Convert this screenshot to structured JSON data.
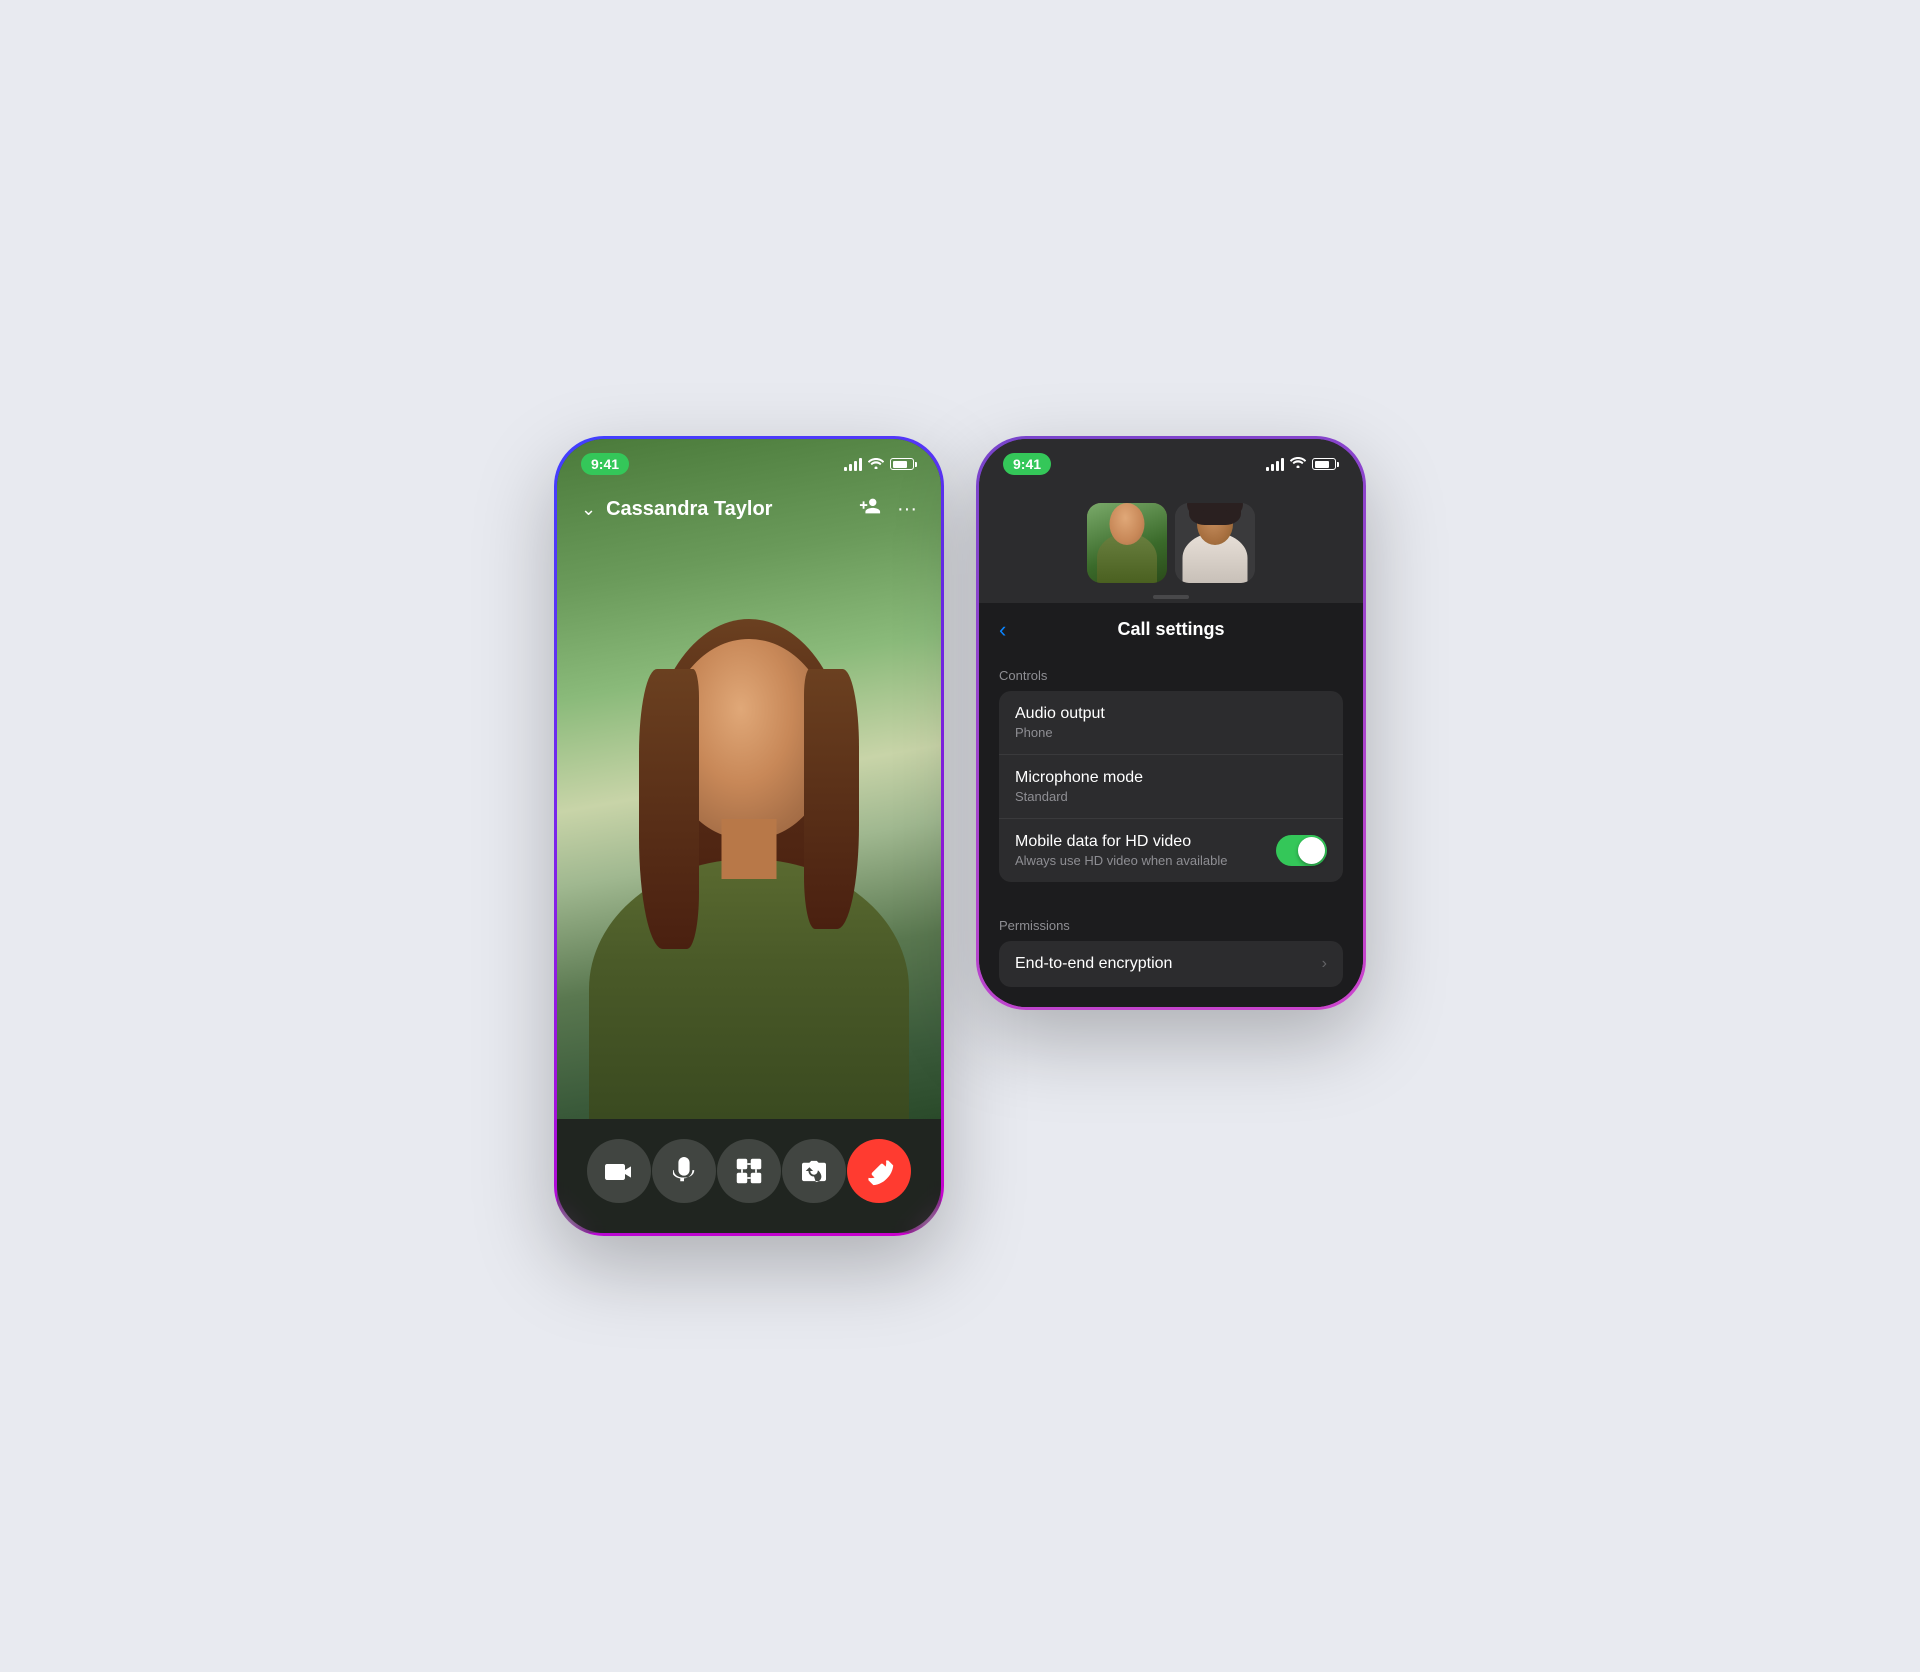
{
  "page": {
    "background": "#e8eaf0"
  },
  "left_phone": {
    "status_bar": {
      "time": "9:41"
    },
    "call_header": {
      "caller_name": "Cassandra Taylor",
      "chevron_label": "‹",
      "add_person_icon": "add-person",
      "more_icon": "more"
    },
    "controls": [
      {
        "id": "video",
        "icon": "🎥",
        "label": "Video"
      },
      {
        "id": "mute",
        "icon": "🎤",
        "label": "Mute"
      },
      {
        "id": "effects",
        "icon": "🎮",
        "label": "Effects"
      },
      {
        "id": "flip",
        "icon": "📷",
        "label": "Flip"
      },
      {
        "id": "end",
        "icon": "📞",
        "label": "End call",
        "type": "end"
      }
    ]
  },
  "right_phone": {
    "status_bar": {
      "time": "9:41"
    },
    "settings": {
      "title": "Call settings",
      "back_label": "‹",
      "sections": [
        {
          "id": "controls",
          "label": "Controls",
          "rows": [
            {
              "id": "audio-output",
              "title": "Audio output",
              "subtitle": "Phone",
              "type": "navigate"
            },
            {
              "id": "microphone-mode",
              "title": "Microphone mode",
              "subtitle": "Standard",
              "type": "navigate"
            },
            {
              "id": "mobile-data-hd",
              "title": "Mobile data for HD video",
              "subtitle": "Always use HD video when available",
              "type": "toggle",
              "toggle_on": true
            }
          ]
        },
        {
          "id": "permissions",
          "label": "Permissions",
          "rows": [
            {
              "id": "e2e-encryption",
              "title": "End-to-end encryption",
              "subtitle": "",
              "type": "navigate"
            }
          ]
        }
      ]
    }
  }
}
